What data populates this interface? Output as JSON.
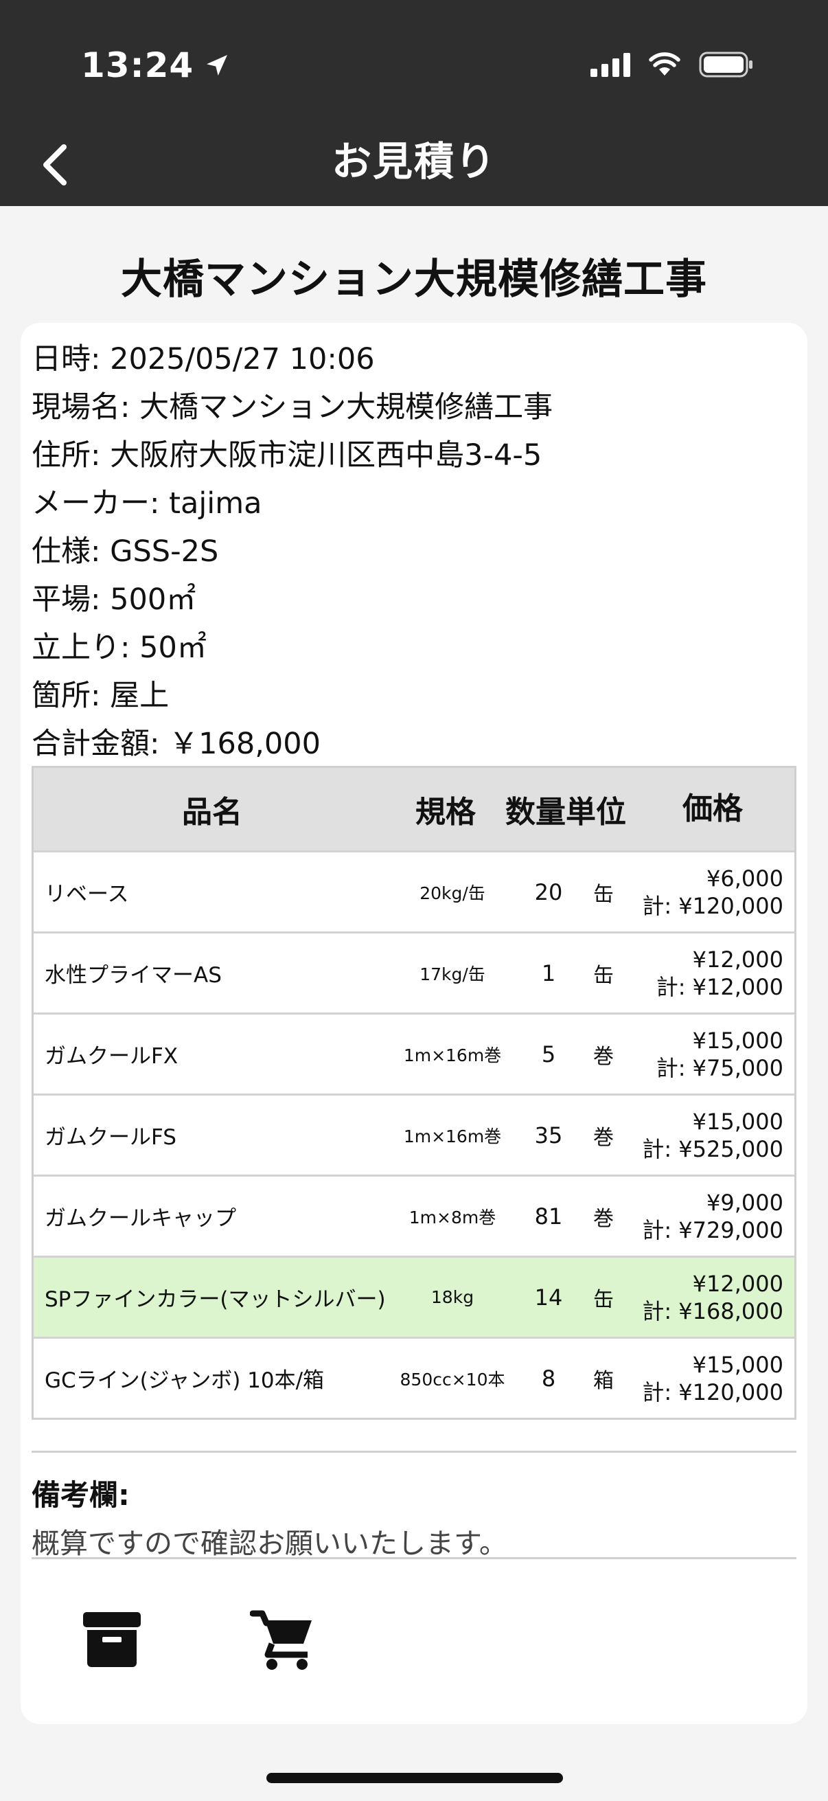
{
  "status_bar": {
    "time": "13:24",
    "icons": [
      "location-arrow-icon",
      "signal-icon",
      "wifi-icon",
      "battery-icon"
    ]
  },
  "header": {
    "title": "お見積り",
    "back_icon": "chevron-left-icon"
  },
  "page": {
    "title": "大橋マンション大規模修繕工事"
  },
  "info": {
    "datetime": "日時: 2025/05/27 10:06",
    "site": "現場名: 大橋マンション大規模修繕工事",
    "address": "住所: 大阪府大阪市淀川区西中島3-4-5",
    "maker": "メーカー: tajima",
    "spec": "仕様: GSS-2S",
    "flat": "平場: 500㎡",
    "rise": "立上り: 50㎡",
    "location": "箇所: 屋上",
    "total": "合計金額: ￥168,000"
  },
  "table": {
    "headers": {
      "name": "品名",
      "spec": "規格",
      "qty_unit": "数量単位",
      "price": "価格"
    },
    "rows": [
      {
        "name": "リベース",
        "spec": "20kg/缶",
        "qty": "20",
        "unit": "缶",
        "price": "¥6,000",
        "subtotal": "計: ¥120,000"
      },
      {
        "name": "水性プライマーAS",
        "spec": "17kg/缶",
        "qty": "1",
        "unit": "缶",
        "price": "¥12,000",
        "subtotal": "計: ¥12,000"
      },
      {
        "name": "ガムクールFX",
        "spec": "1m×16m巻",
        "qty": "5",
        "unit": "巻",
        "price": "¥15,000",
        "subtotal": "計: ¥75,000"
      },
      {
        "name": "ガムクールFS",
        "spec": "1m×16m巻",
        "qty": "35",
        "unit": "巻",
        "price": "¥15,000",
        "subtotal": "計: ¥525,000"
      },
      {
        "name": "ガムクールキャップ",
        "spec": "1m×8m巻",
        "qty": "81",
        "unit": "巻",
        "price": "¥9,000",
        "subtotal": "計: ¥729,000"
      },
      {
        "name": "SPファインカラー(マットシルバー)",
        "spec": "18kg",
        "qty": "14",
        "unit": "缶",
        "price": "¥12,000",
        "subtotal": "計: ¥168,000",
        "highlighted": true
      },
      {
        "name": "GCライン(ジャンボ) 10本/箱",
        "spec": "850cc×10本",
        "qty": "8",
        "unit": "箱",
        "price": "¥15,000",
        "subtotal": "計: ¥120,000"
      }
    ],
    "highlight_color": "#dcf5cf"
  },
  "remarks": {
    "label": "備考欄:",
    "text": "概算ですので確認お願いいたします。"
  },
  "actions": {
    "archive_icon": "archive-box-icon",
    "cart_icon": "shopping-cart-icon"
  },
  "colors": {
    "header_bg": "#2e2e2e",
    "page_bg": "#f4f4f4",
    "table_header_bg": "#e0e0e0"
  }
}
